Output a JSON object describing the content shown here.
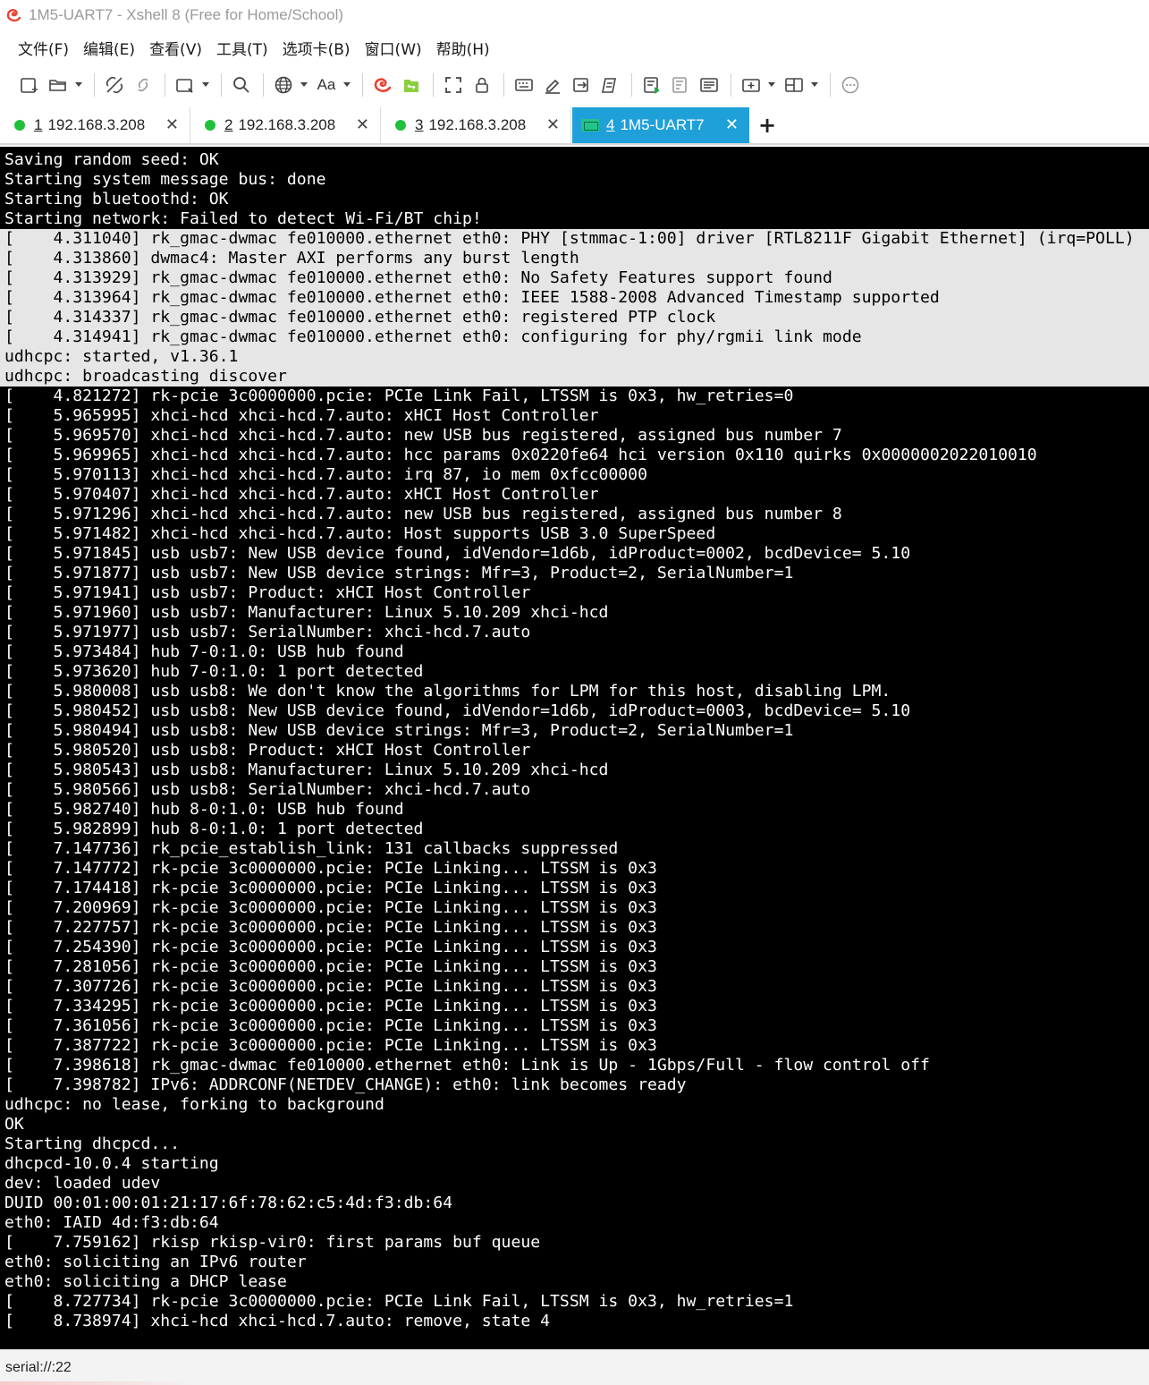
{
  "window": {
    "title": "1M5-UART7 - Xshell 8 (Free for Home/School)"
  },
  "menu": [
    {
      "label": "文件(F)"
    },
    {
      "label": "编辑(E)"
    },
    {
      "label": "查看(V)"
    },
    {
      "label": "工具(T)"
    },
    {
      "label": "选项卡(B)"
    },
    {
      "label": "窗口(W)"
    },
    {
      "label": "帮助(H)"
    }
  ],
  "toolbar": {
    "font_label": "Aa"
  },
  "tabs": [
    {
      "num": "1",
      "label": "192.168.3.208",
      "status_color": "#1fc13b",
      "active": false
    },
    {
      "num": "2",
      "label": "192.168.3.208",
      "status_color": "#1fc13b",
      "active": false
    },
    {
      "num": "3",
      "label": "192.168.3.208",
      "status_color": "#1fc13b",
      "active": false
    },
    {
      "num": "4",
      "label": "1M5-UART7",
      "status_color": "#22c489",
      "active": true
    }
  ],
  "tab_close_glyph": "✕",
  "tab_add_glyph": "+",
  "terminal": {
    "lines": [
      {
        "text": "Saving random seed: OK",
        "sel": false
      },
      {
        "text": "Starting system message bus: done",
        "sel": false
      },
      {
        "text": "Starting bluetoothd: OK",
        "sel": false
      },
      {
        "text": "Starting network: Failed to detect Wi-Fi/BT chip!",
        "sel": false
      },
      {
        "text": "[    4.311040] rk_gmac-dwmac fe010000.ethernet eth0: PHY [stmmac-1:00] driver [RTL8211F Gigabit Ethernet] (irq=POLL)",
        "sel": true
      },
      {
        "text": "[    4.313860] dwmac4: Master AXI performs any burst length",
        "sel": true
      },
      {
        "text": "[    4.313929] rk_gmac-dwmac fe010000.ethernet eth0: No Safety Features support found",
        "sel": true
      },
      {
        "text": "[    4.313964] rk_gmac-dwmac fe010000.ethernet eth0: IEEE 1588-2008 Advanced Timestamp supported",
        "sel": true
      },
      {
        "text": "[    4.314337] rk_gmac-dwmac fe010000.ethernet eth0: registered PTP clock",
        "sel": true
      },
      {
        "text": "[    4.314941] rk_gmac-dwmac fe010000.ethernet eth0: configuring for phy/rgmii link mode",
        "sel": true
      },
      {
        "text": "udhcpc: started, v1.36.1",
        "sel": true
      },
      {
        "text": "udhcpc: broadcasting discover",
        "sel": true
      },
      {
        "text": "[    4.821272] rk-pcie 3c0000000.pcie: PCIe Link Fail, LTSSM is 0x3, hw_retries=0",
        "sel": false
      },
      {
        "text": "[    5.965995] xhci-hcd xhci-hcd.7.auto: xHCI Host Controller",
        "sel": false
      },
      {
        "text": "[    5.969570] xhci-hcd xhci-hcd.7.auto: new USB bus registered, assigned bus number 7",
        "sel": false
      },
      {
        "text": "[    5.969965] xhci-hcd xhci-hcd.7.auto: hcc params 0x0220fe64 hci version 0x110 quirks 0x0000002022010010",
        "sel": false
      },
      {
        "text": "[    5.970113] xhci-hcd xhci-hcd.7.auto: irq 87, io mem 0xfcc00000",
        "sel": false
      },
      {
        "text": "[    5.970407] xhci-hcd xhci-hcd.7.auto: xHCI Host Controller",
        "sel": false
      },
      {
        "text": "[    5.971296] xhci-hcd xhci-hcd.7.auto: new USB bus registered, assigned bus number 8",
        "sel": false
      },
      {
        "text": "[    5.971482] xhci-hcd xhci-hcd.7.auto: Host supports USB 3.0 SuperSpeed",
        "sel": false
      },
      {
        "text": "[    5.971845] usb usb7: New USB device found, idVendor=1d6b, idProduct=0002, bcdDevice= 5.10",
        "sel": false
      },
      {
        "text": "[    5.971877] usb usb7: New USB device strings: Mfr=3, Product=2, SerialNumber=1",
        "sel": false
      },
      {
        "text": "[    5.971941] usb usb7: Product: xHCI Host Controller",
        "sel": false
      },
      {
        "text": "[    5.971960] usb usb7: Manufacturer: Linux 5.10.209 xhci-hcd",
        "sel": false
      },
      {
        "text": "[    5.971977] usb usb7: SerialNumber: xhci-hcd.7.auto",
        "sel": false
      },
      {
        "text": "[    5.973484] hub 7-0:1.0: USB hub found",
        "sel": false
      },
      {
        "text": "[    5.973620] hub 7-0:1.0: 1 port detected",
        "sel": false
      },
      {
        "text": "[    5.980008] usb usb8: We don't know the algorithms for LPM for this host, disabling LPM.",
        "sel": false
      },
      {
        "text": "[    5.980452] usb usb8: New USB device found, idVendor=1d6b, idProduct=0003, bcdDevice= 5.10",
        "sel": false
      },
      {
        "text": "[    5.980494] usb usb8: New USB device strings: Mfr=3, Product=2, SerialNumber=1",
        "sel": false
      },
      {
        "text": "[    5.980520] usb usb8: Product: xHCI Host Controller",
        "sel": false
      },
      {
        "text": "[    5.980543] usb usb8: Manufacturer: Linux 5.10.209 xhci-hcd",
        "sel": false
      },
      {
        "text": "[    5.980566] usb usb8: SerialNumber: xhci-hcd.7.auto",
        "sel": false
      },
      {
        "text": "[    5.982740] hub 8-0:1.0: USB hub found",
        "sel": false
      },
      {
        "text": "[    5.982899] hub 8-0:1.0: 1 port detected",
        "sel": false
      },
      {
        "text": "[    7.147736] rk_pcie_establish_link: 131 callbacks suppressed",
        "sel": false
      },
      {
        "text": "[    7.147772] rk-pcie 3c0000000.pcie: PCIe Linking... LTSSM is 0x3",
        "sel": false
      },
      {
        "text": "[    7.174418] rk-pcie 3c0000000.pcie: PCIe Linking... LTSSM is 0x3",
        "sel": false
      },
      {
        "text": "[    7.200969] rk-pcie 3c0000000.pcie: PCIe Linking... LTSSM is 0x3",
        "sel": false
      },
      {
        "text": "[    7.227757] rk-pcie 3c0000000.pcie: PCIe Linking... LTSSM is 0x3",
        "sel": false
      },
      {
        "text": "[    7.254390] rk-pcie 3c0000000.pcie: PCIe Linking... LTSSM is 0x3",
        "sel": false
      },
      {
        "text": "[    7.281056] rk-pcie 3c0000000.pcie: PCIe Linking... LTSSM is 0x3",
        "sel": false
      },
      {
        "text": "[    7.307726] rk-pcie 3c0000000.pcie: PCIe Linking... LTSSM is 0x3",
        "sel": false
      },
      {
        "text": "[    7.334295] rk-pcie 3c0000000.pcie: PCIe Linking... LTSSM is 0x3",
        "sel": false
      },
      {
        "text": "[    7.361056] rk-pcie 3c0000000.pcie: PCIe Linking... LTSSM is 0x3",
        "sel": false
      },
      {
        "text": "[    7.387722] rk-pcie 3c0000000.pcie: PCIe Linking... LTSSM is 0x3",
        "sel": false
      },
      {
        "text": "[    7.398618] rk_gmac-dwmac fe010000.ethernet eth0: Link is Up - 1Gbps/Full - flow control off",
        "sel": false
      },
      {
        "text": "[    7.398782] IPv6: ADDRCONF(NETDEV_CHANGE): eth0: link becomes ready",
        "sel": false
      },
      {
        "text": "udhcpc: no lease, forking to background",
        "sel": false
      },
      {
        "text": "OK",
        "sel": false
      },
      {
        "text": "Starting dhcpcd...",
        "sel": false
      },
      {
        "text": "dhcpcd-10.0.4 starting",
        "sel": false
      },
      {
        "text": "dev: loaded udev",
        "sel": false
      },
      {
        "text": "DUID 00:01:00:01:21:17:6f:78:62:c5:4d:f3:db:64",
        "sel": false
      },
      {
        "text": "eth0: IAID 4d:f3:db:64",
        "sel": false
      },
      {
        "text": "[    7.759162] rkisp rkisp-vir0: first params buf queue",
        "sel": false
      },
      {
        "text": "eth0: soliciting an IPv6 router",
        "sel": false
      },
      {
        "text": "eth0: soliciting a DHCP lease",
        "sel": false
      },
      {
        "text": "[    8.727734] rk-pcie 3c0000000.pcie: PCIe Link Fail, LTSSM is 0x3, hw_retries=1",
        "sel": false
      },
      {
        "text": "[    8.738974] xhci-hcd xhci-hcd.7.auto: remove, state 4",
        "sel": false
      }
    ],
    "bg_color": "#000000",
    "fg_color": "#ffffff",
    "selection_bg": "#e6e6e6"
  },
  "statusbar": {
    "text": "serial://:22"
  },
  "colors": {
    "accent": "#1fa0d9",
    "connected": "#1fc13b"
  }
}
